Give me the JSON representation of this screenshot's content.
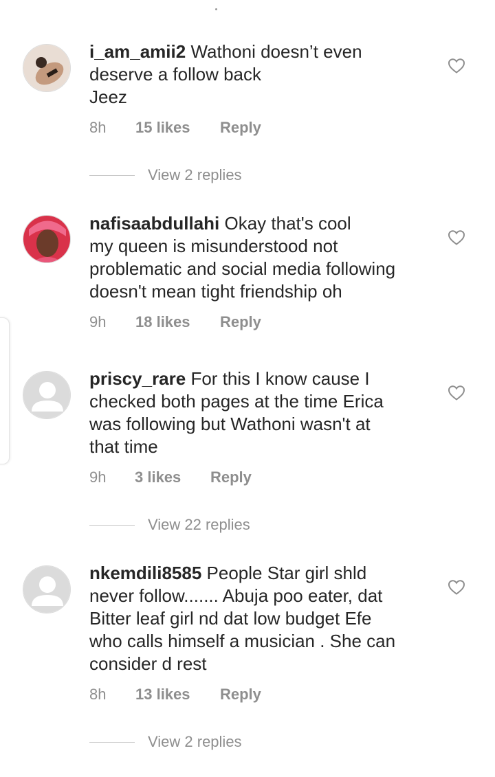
{
  "comments": [
    {
      "username": "i_am_amii2",
      "text": "Wathoni doesn’t even\ndeserve a follow back\nJeez",
      "time": "8h",
      "likes": "15 likes",
      "reply": "Reply",
      "avatar": "photo-avatar",
      "view_replies": "View 2 replies"
    },
    {
      "username": "nafisaabdullahi",
      "text": "Okay that's cool\nmy queen is misunderstood not\nproblematic and social media following\ndoesn't mean tight friendship oh",
      "time": "9h",
      "likes": "18 likes",
      "reply": "Reply",
      "avatar": "photo-avatar"
    },
    {
      "username": "priscy_rare",
      "text": "For this I know cause I\nchecked both pages at the time Erica\nwas following but Wathoni wasn't at\nthat time",
      "time": "9h",
      "likes": "3 likes",
      "reply": "Reply",
      "avatar": "default-avatar",
      "view_replies": "View 22 replies"
    },
    {
      "username": "nkemdili8585",
      "text": "People Star girl shld\nnever follow....... Abuja poo eater, dat\nBitter leaf girl nd dat low budget Efe\nwho calls himself a musician . She can\nconsider d rest",
      "time": "8h",
      "likes": "13 likes",
      "reply": "Reply",
      "avatar": "default-avatar",
      "view_replies": "View 2 replies"
    }
  ],
  "colors": {
    "text": "#262626",
    "meta": "#8e8e8e",
    "heart": "#8e8e8e"
  },
  "icons": {
    "like": "heart-outline-icon",
    "default_avatar": "person-silhouette-icon"
  }
}
